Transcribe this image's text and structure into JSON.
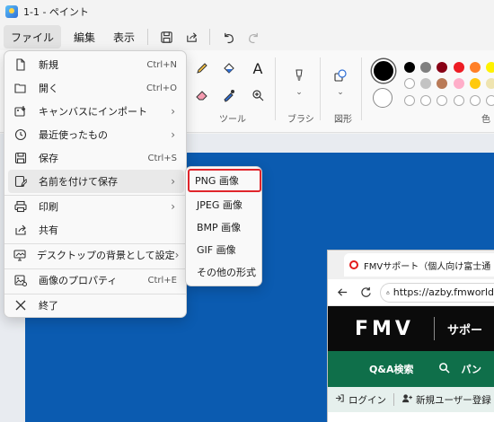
{
  "window": {
    "title": "1-1 - ペイント"
  },
  "menubar": {
    "items": [
      "ファイル",
      "編集",
      "表示"
    ],
    "icons": [
      "save-icon",
      "share-icon",
      "undo-icon",
      "redo-icon"
    ]
  },
  "ribbon": {
    "groups": [
      "ツール",
      "ブラシ",
      "図形",
      "色"
    ],
    "text_tool": "A",
    "colors": [
      "#000000",
      "#7f7f7f",
      "#880015",
      "#ed1c24",
      "#ff7f27",
      "#fff200",
      "#c3c3c3",
      "#ffc90e"
    ],
    "primary_color": "#000000",
    "secondary_color": "#ffffff"
  },
  "file_menu": {
    "items": [
      {
        "label": "新規",
        "shortcut": "Ctrl+N",
        "icon": "new-file-icon"
      },
      {
        "label": "開く",
        "shortcut": "Ctrl+O",
        "icon": "folder-open-icon"
      },
      {
        "label": "キャンバスにインポート",
        "submenu": true,
        "icon": "import-canvas-icon"
      },
      {
        "label": "最近使ったもの",
        "submenu": true,
        "icon": "clock-icon"
      },
      {
        "label": "保存",
        "shortcut": "Ctrl+S",
        "icon": "save-icon"
      },
      {
        "label": "名前を付けて保存",
        "submenu": true,
        "icon": "save-as-icon"
      },
      {
        "label": "印刷",
        "submenu": true,
        "icon": "print-icon"
      },
      {
        "label": "共有",
        "icon": "share-icon"
      },
      {
        "label": "デスクトップの背景として設定",
        "submenu": true,
        "icon": "desktop-background-icon"
      },
      {
        "label": "画像のプロパティ",
        "shortcut": "Ctrl+E",
        "icon": "image-properties-icon"
      },
      {
        "label": "終了",
        "icon": "close-icon"
      }
    ]
  },
  "save_as_submenu": {
    "items": [
      "PNG 画像",
      "JPEG 画像",
      "BMP 画像",
      "GIF 画像",
      "その他の形式"
    ],
    "selected": "PNG 画像"
  },
  "browser": {
    "tab_title": "FMVサポート（個人向け富士通",
    "url": "https://azby.fmworld",
    "logo": "FMV",
    "site_section": "サポー",
    "nav_items": [
      "Q&A検索",
      "パン"
    ],
    "login": "ログイン",
    "new_user": "新規ユーザー登録"
  },
  "colors": {
    "canvas_blue": "#0b5bb0",
    "fmv_green": "#0f6f4a",
    "selection_red": "#e0252b"
  }
}
